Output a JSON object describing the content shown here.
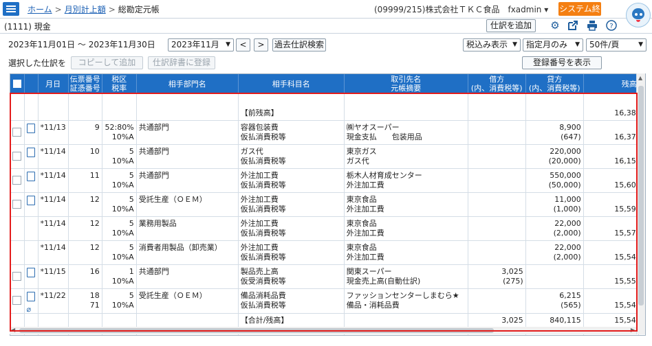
{
  "header": {
    "breadcrumbs": [
      "ホーム",
      "月別計上額",
      "総勘定元帳"
    ],
    "company": "(09999/215)株式会社ＴＫＣ食品　fxadmin ▾",
    "exit_label": "システム終了"
  },
  "toolbar": {
    "account": "(1111) 現金",
    "add_entry_label": "仕訳を追加",
    "icons": [
      "gear-icon",
      "external-link-icon",
      "print-icon",
      "help-icon"
    ]
  },
  "filters": {
    "date_range": "2023年11月01日 ～ 2023年11月30日",
    "month_value": "2023年11月",
    "prev_label": "<",
    "next_label": ">",
    "past_search_label": "過去仕訳検索",
    "tax_display": "税込み表示",
    "month_mode": "指定月のみ",
    "per_page": "50件/頁"
  },
  "selection": {
    "label": "選択した仕訳を",
    "copy_label": "コピーして追加",
    "dict_label": "仕訳辞書に登録",
    "show_reg_label": "登録番号を表示"
  },
  "table": {
    "headers": {
      "date": "月日",
      "slip": [
        "伝票番号",
        "証憑番号"
      ],
      "tax": [
        "税区",
        "税率"
      ],
      "dept": "相手部門名",
      "subject": "相手科目名",
      "partner": [
        "取引先名",
        "元帳摘要"
      ],
      "debit": [
        "借方",
        "(内、消費税等)"
      ],
      "credit": [
        "貸方",
        "(内、消費税等)"
      ],
      "balance": "残高"
    },
    "opening": {
      "label": "【前残高】",
      "balance": "16,38"
    },
    "rows": [
      {
        "date": "*11/13",
        "slip": "9",
        "slip2": "",
        "tax": "52:80%",
        "rate": "10%A",
        "dept": "共通部門",
        "subj1": "容器包装費",
        "subj2": "仮払消費税等",
        "part1": "㈱ヤオスーパー",
        "part2": "現金支払　　包装用品",
        "debit": "",
        "debit_tax": "",
        "credit": "8,900",
        "credit_tax": "(647)",
        "balance": "16,37",
        "memo": true,
        "clip": false
      },
      {
        "date": "*11/14",
        "slip": "10",
        "slip2": "",
        "tax": "5",
        "rate": "10%A",
        "dept": "共通部門",
        "subj1": "ガス代",
        "subj2": "仮払消費税等",
        "part1": "東京ガス",
        "part2": "ガス代",
        "debit": "",
        "debit_tax": "",
        "credit": "220,000",
        "credit_tax": "(20,000)",
        "balance": "16,15",
        "memo": true,
        "clip": false
      },
      {
        "date": "*11/14",
        "slip": "11",
        "slip2": "",
        "tax": "5",
        "rate": "10%A",
        "dept": "共通部門",
        "subj1": "外注加工費",
        "subj2": "仮払消費税等",
        "part1": "栃木人材育成センター",
        "part2": "外注加工費",
        "debit": "",
        "debit_tax": "",
        "credit": "550,000",
        "credit_tax": "(50,000)",
        "balance": "15,60",
        "memo": true,
        "clip": false
      },
      {
        "date": "*11/14",
        "slip": "12",
        "slip2": "",
        "tax": "5",
        "rate": "10%A",
        "dept": "受託生産（ＯＥＭ）",
        "subj1": "外注加工費",
        "subj2": "仮払消費税等",
        "part1": "東京食品",
        "part2": "外注加工費",
        "debit": "",
        "debit_tax": "",
        "credit": "11,000",
        "credit_tax": "(1,000)",
        "balance": "15,59",
        "memo": true,
        "clip": false
      },
      {
        "date": "*11/14",
        "slip": "12",
        "slip2": "",
        "tax": "5",
        "rate": "10%A",
        "dept": "業務用製品",
        "subj1": "外注加工費",
        "subj2": "仮払消費税等",
        "part1": "東京食品",
        "part2": "外注加工費",
        "debit": "",
        "debit_tax": "",
        "credit": "22,000",
        "credit_tax": "(2,000)",
        "balance": "15,57",
        "memo": false,
        "clip": false
      },
      {
        "date": "*11/14",
        "slip": "12",
        "slip2": "",
        "tax": "5",
        "rate": "10%A",
        "dept": "消費者用製品（卸売業）",
        "subj1": "外注加工費",
        "subj2": "仮払消費税等",
        "part1": "東京食品",
        "part2": "外注加工費",
        "debit": "",
        "debit_tax": "",
        "credit": "22,000",
        "credit_tax": "(2,000)",
        "balance": "15,54",
        "memo": false,
        "clip": false
      },
      {
        "date": "*11/15",
        "slip": "16",
        "slip2": "",
        "tax": "1",
        "rate": "10%A",
        "dept": "共通部門",
        "subj1": "製品売上高",
        "subj2": "仮受消費税等",
        "part1": "関東スーパー",
        "part2": "現金売上高(自動仕訳)",
        "debit": "3,025",
        "debit_tax": "(275)",
        "credit": "",
        "credit_tax": "",
        "balance": "15,55",
        "memo": true,
        "clip": false
      },
      {
        "date": "*11/22",
        "slip": "18",
        "slip2": "71",
        "tax": "5",
        "rate": "10%A",
        "dept": "受託生産（ＯＥＭ）",
        "subj1": "備品消耗品費",
        "subj2": "仮払消費税等",
        "part1": "ファッションセンターしまむら★",
        "part2": "備品・消耗品費",
        "debit": "",
        "debit_tax": "",
        "credit": "6,215",
        "credit_tax": "(565)",
        "balance": "15,54",
        "memo": true,
        "clip": true
      }
    ],
    "summary": {
      "label": "【合計/残高】",
      "debit": "3,025",
      "credit": "840,115",
      "balance": "15,54"
    }
  }
}
